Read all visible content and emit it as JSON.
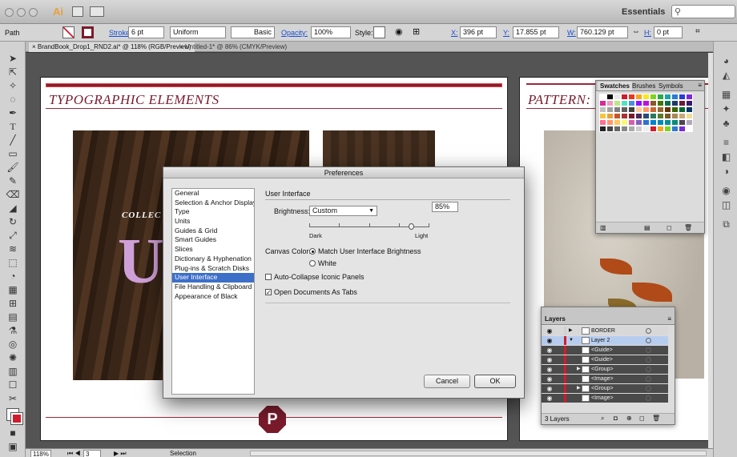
{
  "app": {
    "essentials_label": "Essentials",
    "selection_kind": "Path"
  },
  "control_bar": {
    "stroke_label": "Stroke:",
    "stroke_value": "6 pt",
    "profile_value": "Uniform",
    "brush_value": "Basic",
    "opacity_label": "Opacity:",
    "opacity_value": "100%",
    "style_label": "Style:",
    "x_label": "X:",
    "x_value": "396 pt",
    "y_label": "Y:",
    "y_value": "17.855 pt",
    "w_label": "W:",
    "w_value": "760.129 pt",
    "h_label": "H:",
    "h_value": "0 pt"
  },
  "doc_tabs": [
    {
      "label": "BrandBook_Drop1_RND2.ai* @ 118% (RGB/Preview)",
      "active": true
    },
    {
      "label": "Untitled-1* @ 86% (CMYK/Preview)",
      "active": false
    }
  ],
  "artboard_left": {
    "title": "TYPOGRAPHIC ELEMENTS",
    "collec_text": "COLLEC",
    "big_text": "UN",
    "badge_letter": "P"
  },
  "artboard_right": {
    "title": "PATTERN:"
  },
  "swatches_panel": {
    "tabs": [
      "Swatches",
      "Brushes",
      "Symbols"
    ],
    "colors": [
      "#ffffff",
      "#000000",
      "#e8e8e8",
      "#d01c2c",
      "#e8391d",
      "#f5a623",
      "#f8e71c",
      "#7ed321",
      "#2ba84a",
      "#1aa5a5",
      "#2a7bd6",
      "#2a3bd6",
      "#7a2ad6",
      "#d62a9a",
      "#f29ac0",
      "#b8e986",
      "#50e3c2",
      "#4a90e2",
      "#9013fe",
      "#bd10e0",
      "#8b572a",
      "#417505",
      "#0b6e4f",
      "#1b3a6b",
      "#6b1b3a",
      "#3a1b6b",
      "#c0c0c0",
      "#a0a0a0",
      "#808080",
      "#606060",
      "#404040",
      "#ffcc99",
      "#ff9966",
      "#cc6633",
      "#996633",
      "#663300",
      "#336600",
      "#006633",
      "#003366",
      "#f4c542",
      "#e8a03a",
      "#c8562a",
      "#a83232",
      "#7a1b2c",
      "#4a2a5a",
      "#2a4a7a",
      "#2a7a5a",
      "#5a7a2a",
      "#7a5a2a",
      "#aa8855",
      "#ccaa77",
      "#eedd99",
      "#ff6f91",
      "#ff9671",
      "#ffc75f",
      "#f9f871",
      "#d65db1",
      "#845ec2",
      "#2c73d2",
      "#0081cf",
      "#0089ba",
      "#008e9b",
      "#008f7a",
      "#4b4453",
      "#b0a8b9",
      "#222222",
      "#444444",
      "#666666",
      "#888888",
      "#aaaaaa",
      "#cccccc",
      "#eeeeee",
      "#d01c2c",
      "#f5a623",
      "#7ed321",
      "#2a7bd6",
      "#7a2ad6",
      "#ffffff"
    ]
  },
  "layers_panel": {
    "title": "Layers",
    "layers": [
      {
        "name": "BORDER",
        "expanded": false,
        "selected": false,
        "sub": false
      },
      {
        "name": "Layer 2",
        "expanded": true,
        "selected": true,
        "sub": false
      },
      {
        "name": "<Guide>",
        "expanded": false,
        "selected": false,
        "sub": true
      },
      {
        "name": "<Guide>",
        "expanded": false,
        "selected": false,
        "sub": true
      },
      {
        "name": "<Group>",
        "expanded": false,
        "selected": false,
        "sub": true
      },
      {
        "name": "<Image>",
        "expanded": false,
        "selected": false,
        "sub": true
      },
      {
        "name": "<Group>",
        "expanded": false,
        "selected": false,
        "sub": true
      },
      {
        "name": "<Image>",
        "expanded": false,
        "selected": false,
        "sub": true
      }
    ],
    "count_label": "3 Layers"
  },
  "status_bar": {
    "zoom": "118%",
    "page": "3",
    "mode": "Selection"
  },
  "preferences": {
    "title": "Preferences",
    "categories": [
      "General",
      "Selection & Anchor Display",
      "Type",
      "Units",
      "Guides & Grid",
      "Smart Guides",
      "Slices",
      "Dictionary & Hyphenation",
      "Plug-ins & Scratch Disks",
      "User Interface",
      "File Handling & Clipboard",
      "Appearance of Black"
    ],
    "selected_category": "User Interface",
    "section_title": "User Interface",
    "brightness_label": "Brightness:",
    "brightness_value": "Custom",
    "brightness_percent": "85%",
    "brightness_level": 0.85,
    "dark_label": "Dark",
    "light_label": "Light",
    "canvas_color_label": "Canvas Color:",
    "canvas_option_match": "Match User Interface Brightness",
    "canvas_option_white": "White",
    "auto_collapse_label": "Auto-Collapse Iconic Panels",
    "auto_collapse_checked": false,
    "open_docs_tabs_label": "Open Documents As Tabs",
    "open_docs_tabs_checked": true,
    "cancel_label": "Cancel",
    "ok_label": "OK"
  }
}
